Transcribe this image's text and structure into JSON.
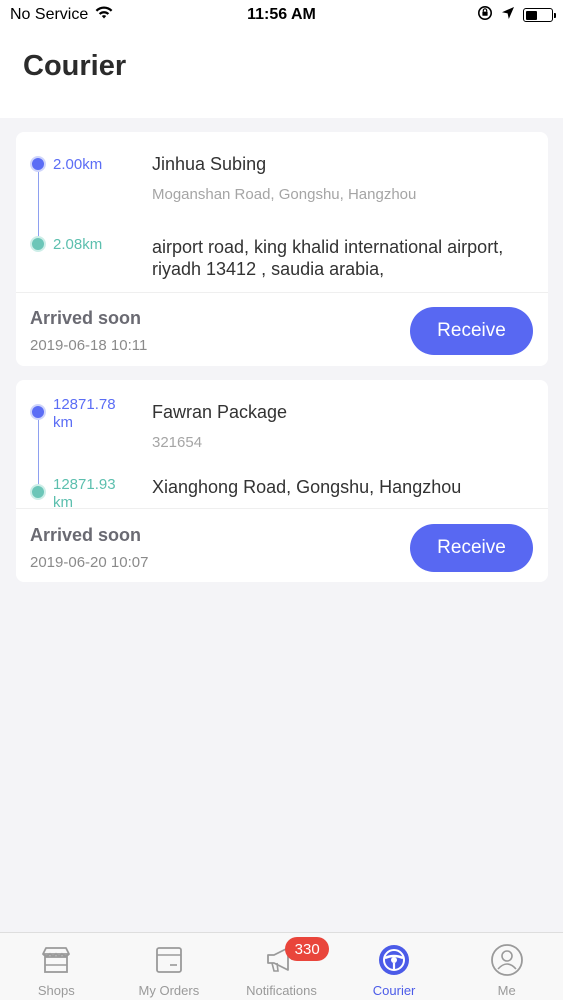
{
  "status_bar": {
    "carrier": "No Service",
    "time": "11:56 AM"
  },
  "header": {
    "title": "Courier"
  },
  "orders": [
    {
      "pickup_distance": "2.00km",
      "dropoff_distance": "2.08km",
      "shop_name": "Jinhua Subing",
      "shop_address": "Moganshan Road, Gongshu, Hangzhou",
      "destination": "airport road, king khalid international airport, riyadh 13412 , saudia arabia,",
      "status": "Arrived soon",
      "time": "2019-06-18 10:11",
      "button_label": "Receive"
    },
    {
      "pickup_distance": "12871.78 km",
      "dropoff_distance": "12871.93 km",
      "shop_name": "Fawran Package",
      "shop_address": "321654",
      "destination": "Xianghong Road, Gongshu, Hangzhou",
      "status": "Arrived soon",
      "time": "2019-06-20 10:07",
      "button_label": "Receive"
    }
  ],
  "tabs": [
    {
      "label": "Shops",
      "icon": "shop-icon"
    },
    {
      "label": "My Orders",
      "icon": "orders-icon"
    },
    {
      "label": "Notifications",
      "icon": "megaphone-icon",
      "badge": "330"
    },
    {
      "label": "Courier",
      "icon": "steering-wheel-icon",
      "active": true
    },
    {
      "label": "Me",
      "icon": "profile-icon"
    }
  ],
  "colors": {
    "accent": "#5868f2",
    "teal": "#6cc6b8",
    "badge": "#e9453b",
    "background": "#f4f4f7"
  }
}
